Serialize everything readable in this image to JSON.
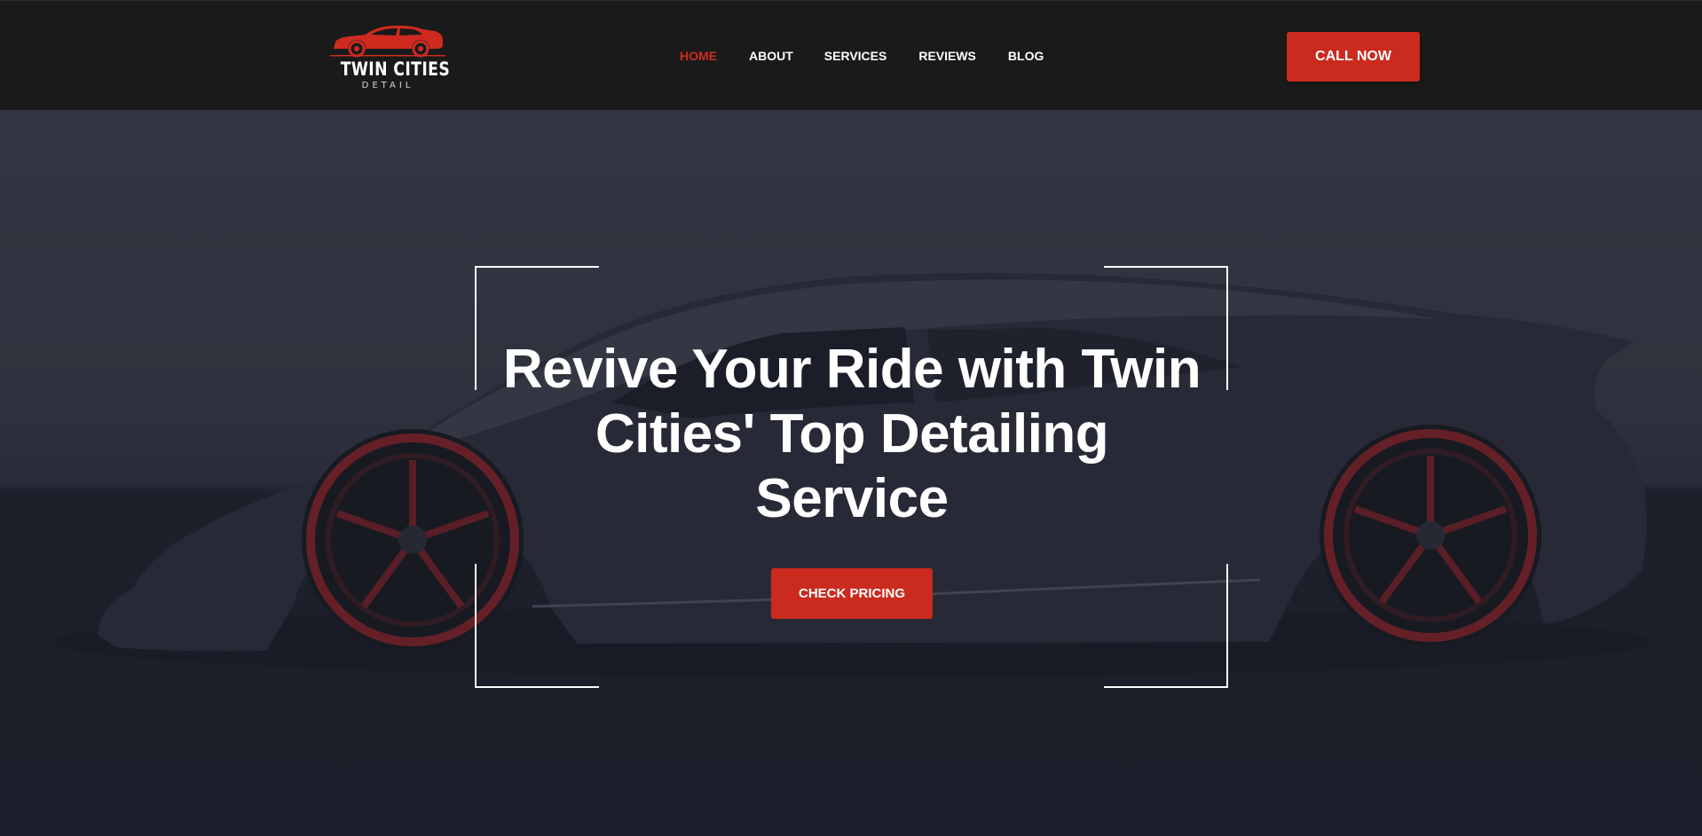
{
  "brand": {
    "name": "TWIN CITIES",
    "subtitle": "DETAIL",
    "logo_icon": "sports-car-icon",
    "accent_color": "#cb2a1f"
  },
  "nav": {
    "items": [
      {
        "label": "HOME",
        "active": true
      },
      {
        "label": "ABOUT",
        "active": false
      },
      {
        "label": "SERVICES",
        "active": false
      },
      {
        "label": "REVIEWS",
        "active": false
      },
      {
        "label": "BLOG",
        "active": false
      }
    ]
  },
  "header": {
    "cta_label": "CALL NOW"
  },
  "hero": {
    "title": "Revive Your Ride with Twin Cities' Top Detailing Service",
    "button_label": "CHECK PRICING",
    "background_image": "dark sports car with red wheels"
  }
}
